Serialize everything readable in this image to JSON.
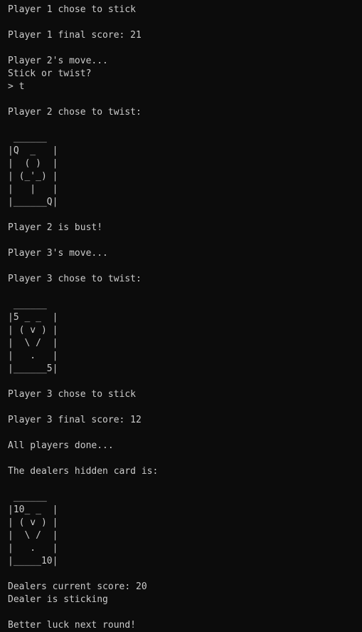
{
  "colors": {
    "background": "#0c0c0c",
    "text": "#cccccc"
  },
  "lines": [
    "Player 1 chose to stick",
    "",
    "Player 1 final score: 21",
    "",
    "Player 2's move...",
    "Stick or twist?",
    "> t",
    "",
    "Player 2 chose to twist:",
    "",
    " ______",
    "|Q  _   |",
    "|  ( )  |",
    "| (_'_) |",
    "|   |   |",
    "|______Q|",
    "",
    "Player 2 is bust!",
    "",
    "Player 3's move...",
    "",
    "Player 3 chose to twist:",
    "",
    " ______",
    "|5 _ _  |",
    "| ( v ) |",
    "|  \\ /  |",
    "|   .   |",
    "|______5|",
    "",
    "Player 3 chose to stick",
    "",
    "Player 3 final score: 12",
    "",
    "All players done...",
    "",
    "The dealers hidden card is:",
    "",
    " ______",
    "|10_ _  |",
    "| ( v ) |",
    "|  \\ /  |",
    "|   .   |",
    "|_____10|",
    "",
    "Dealers current score: 20",
    "Dealer is sticking",
    "",
    "Better luck next round!"
  ]
}
